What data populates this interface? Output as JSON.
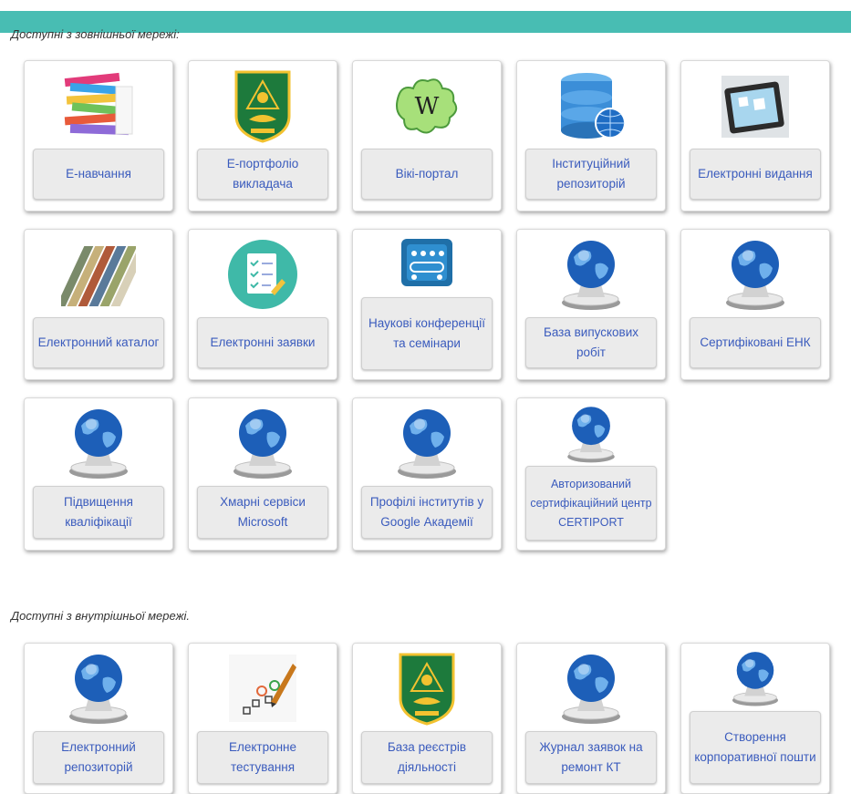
{
  "sections": {
    "external": {
      "title": "Доступні з зовнішньої мережі:"
    },
    "internal": {
      "title": "Доступні з внутрішньої мережі."
    }
  },
  "tiles": {
    "e_learning": {
      "label": "Е-навчання",
      "icon": "books-icon"
    },
    "e_portfolio": {
      "label": "Е-портфоліо викладача",
      "icon": "university-crest-icon"
    },
    "wiki": {
      "label": "Вікі-портал",
      "icon": "wiki-puzzle-icon"
    },
    "institutional_repo": {
      "label": "Інституційний репозиторій",
      "icon": "database-globe-icon"
    },
    "e_publications": {
      "label": "Електронні видання",
      "icon": "ebook-reader-icon"
    },
    "e_catalog": {
      "label": "Електронний каталог",
      "icon": "catalog-books-icon"
    },
    "e_requests": {
      "label": "Електронні заявки",
      "icon": "checklist-icon"
    },
    "conferences": {
      "label": "Наукові конференції та семінари",
      "icon": "conference-icon"
    },
    "graduate_works": {
      "label": "База випускових робіт",
      "icon": "globe-icon"
    },
    "certified_enk": {
      "label": "Сертифіковані ЕНК",
      "icon": "globe-icon"
    },
    "qualification": {
      "label": "Підвищення кваліфікації",
      "icon": "globe-icon"
    },
    "microsoft_cloud": {
      "label": "Хмарні сервіси Microsoft",
      "icon": "globe-icon"
    },
    "google_scholar": {
      "label": "Профілі інститутів у Google Академії",
      "icon": "globe-icon"
    },
    "certiport": {
      "label": "Авторизований сертифікаційний центр CERTIPORT",
      "icon": "globe-icon"
    },
    "e_repository": {
      "label": "Електронний репозиторій",
      "icon": "globe-icon"
    },
    "e_testing": {
      "label": "Електронне тестування",
      "icon": "test-survey-icon"
    },
    "registry_base": {
      "label": "База реєстрів діяльності",
      "icon": "university-crest-icon"
    },
    "repair_log": {
      "label": "Журнал заявок на ремонт КТ",
      "icon": "globe-icon"
    },
    "corporate_mail": {
      "label": "Створення корпоративної пошти",
      "icon": "globe-icon"
    }
  },
  "colors": {
    "topbar": "#48bdb3",
    "label_text": "#3a5bbd",
    "label_bg": "#ebebeb"
  }
}
